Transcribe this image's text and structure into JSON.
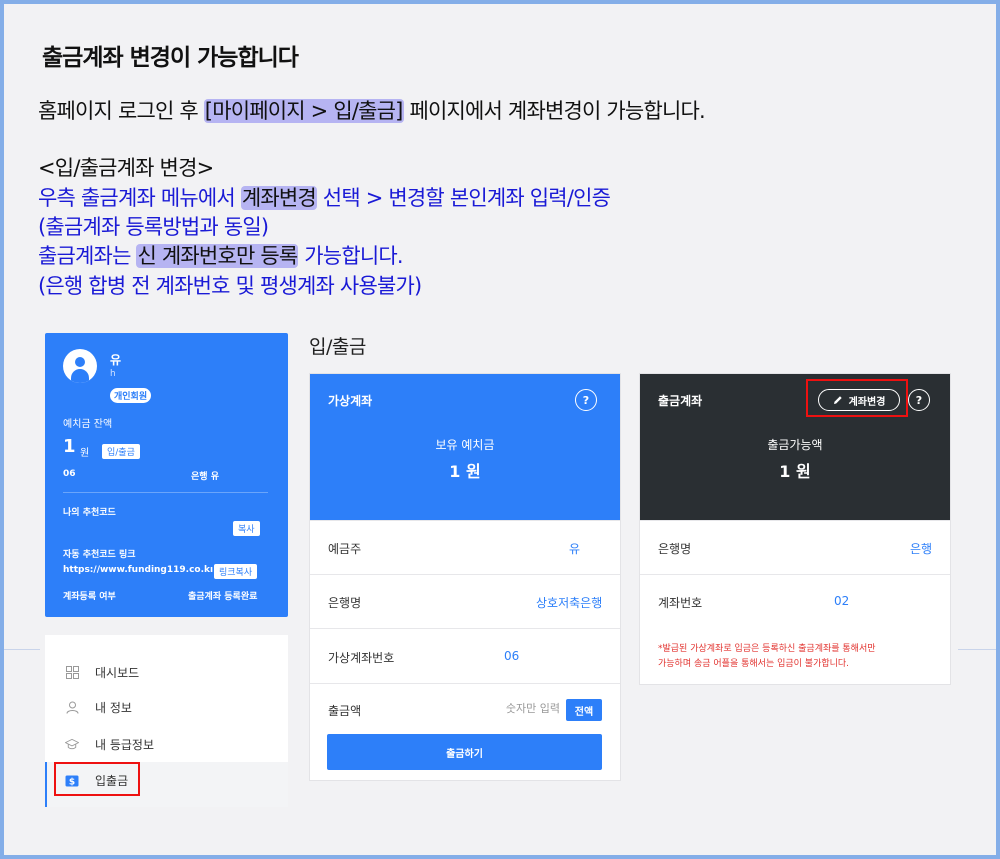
{
  "guide": {
    "heading": "출금계좌 변경이 가능합니다",
    "line1": {
      "a": "홈페이지 로그인 후 ",
      "hl": "[마이페이지 > 입/출금]",
      "b": " 페이지에서 계좌변경이 가능합니다."
    },
    "line2": "<입/출금계좌 변경>",
    "line3": {
      "a": "우측 출금계좌 메뉴에서 ",
      "hl": "계좌변경",
      "b": " 선택 > 변경할 본인계좌 입력/인증"
    },
    "line4": "(출금계좌 등록방법과 동일)",
    "line5": {
      "a": "출금계좌는 ",
      "hl": "신 계좌번호만 등록",
      "b": " 가능합니다."
    },
    "line6": "(은행 합병 전 계좌번호 및 평생계좌 사용불가)"
  },
  "profile": {
    "name": "유",
    "sub": "h",
    "member_badge": "개인회원",
    "balance_label": "예치금 잔액",
    "balance": "1",
    "balance_unit": "원",
    "deposit_chip": "입/출금",
    "account_no": "06",
    "bank": "은행 유",
    "referral_label": "나의 추천코드",
    "copy_chip": "복사",
    "auto_link_label": "자동 추천코드 링크",
    "link_url": "https://www.funding119.co.kı",
    "link_copy_chip": "링크복사",
    "account_reg_label": "계좌등록 여부",
    "account_reg_status": "출금계좌 등록완료"
  },
  "sidebar": {
    "items": [
      {
        "label": "대시보드",
        "icon": "dashboard-icon"
      },
      {
        "label": "내 정보",
        "icon": "user-icon"
      },
      {
        "label": "내 등급정보",
        "icon": "graduation-cap-icon"
      },
      {
        "label": "입출금",
        "icon": "dollar-icon"
      }
    ]
  },
  "section_title": "입/출금",
  "virtual_card": {
    "title": "가상계좌",
    "help": "?",
    "caption": "보유 예치금",
    "value": "1 원",
    "rows": [
      {
        "label": "예금주",
        "value": "유"
      },
      {
        "label": "은행명",
        "value": "상호저축은행"
      },
      {
        "label": "가상계좌번호",
        "value": "06"
      }
    ],
    "withdraw_label": "출금액",
    "withdraw_placeholder": "숫자만 입력",
    "all_button": "전액",
    "submit_button": "출금하기"
  },
  "withdraw_card": {
    "title": "출금계좌",
    "change_button": "계좌변경",
    "help": "?",
    "caption": "출금가능액",
    "value": "1 원",
    "rows": [
      {
        "label": "은행명",
        "value": "은행"
      },
      {
        "label": "계좌번호",
        "value": "02"
      }
    ],
    "notice_line1": "*발급된 가상계좌로 입금은 등록하신 출금계좌를 통해서만",
    "notice_line2": "가능하며 송금 어플을 통해서는 입금이 불가합니다."
  },
  "colors": {
    "primary": "#2d7ff9",
    "dark": "#2a2f33",
    "highlight": "#b6b4f2",
    "guide_blue": "#1a1ad6",
    "alert_red": "#e2332f"
  }
}
